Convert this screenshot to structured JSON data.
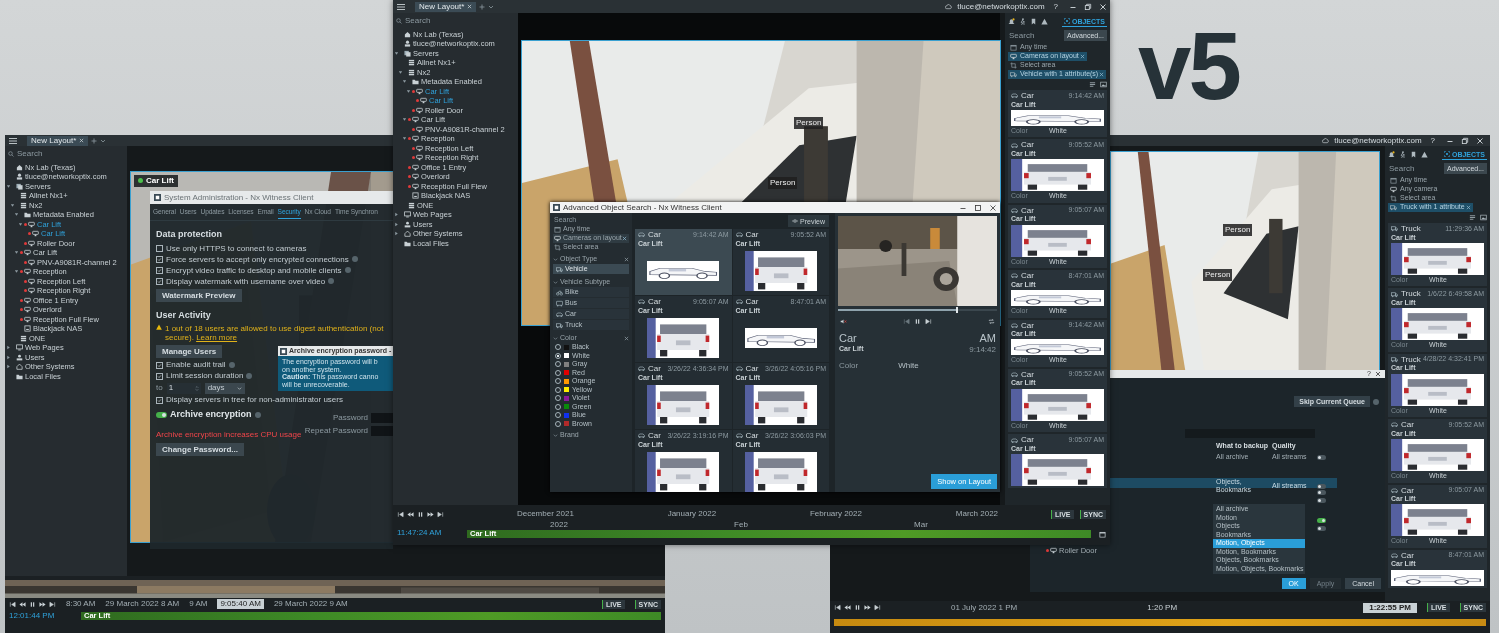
{
  "badge": {
    "label": "v5"
  },
  "left_window": {
    "tabs": [
      {
        "label": "New Layout*",
        "selected": true
      }
    ],
    "search": {
      "placeholder": "Search"
    },
    "tree": [
      {
        "label": "Nx Lab (Texas)",
        "kind": "site",
        "selected": false
      },
      {
        "label": "tluce@networkoptix.com",
        "kind": "user",
        "selected": false
      },
      {
        "label": "Servers",
        "kind": "servers",
        "selected": false,
        "expanded": true,
        "children": [
          {
            "label": "Allnet Nx1+",
            "kind": "server",
            "selected": false
          },
          {
            "label": "Nx2",
            "kind": "server",
            "selected": false,
            "expanded": true,
            "children": [
              {
                "label": "Metadata Enabled",
                "kind": "folder",
                "selected": false,
                "expanded": true,
                "children": [
                  {
                    "label": "Car Lift",
                    "kind": "camera",
                    "selected": true,
                    "recording": true,
                    "expanded": true,
                    "children": [
                      {
                        "label": "Car Lift",
                        "kind": "camera",
                        "selected": true,
                        "recording": true
                      }
                    ]
                  },
                  {
                    "label": "Roller Door",
                    "kind": "camera",
                    "selected": false,
                    "recording": true
                  }
                ]
              },
              {
                "label": "Car Lift",
                "kind": "camera",
                "selected": false,
                "recording": true,
                "expanded": true,
                "children": [
                  {
                    "label": "PNV-A9081R-channel 2",
                    "kind": "camera",
                    "selected": false,
                    "recording": true
                  }
                ]
              },
              {
                "label": "Reception",
                "kind": "camera",
                "selected": false,
                "recording": true,
                "expanded": true,
                "children": [
                  {
                    "label": "Reception Left",
                    "kind": "camera",
                    "selected": false,
                    "recording": true
                  },
                  {
                    "label": "Reception Right",
                    "kind": "camera",
                    "selected": false,
                    "recording": true
                  }
                ]
              },
              {
                "label": "Office 1 Entry",
                "kind": "camera",
                "selected": false,
                "recording": true
              },
              {
                "label": "Overlord",
                "kind": "camera",
                "selected": false,
                "recording": true
              },
              {
                "label": "Reception Full Flew",
                "kind": "camera",
                "selected": false,
                "recording": true
              },
              {
                "label": "Blackjack NAS",
                "kind": "nas",
                "selected": false
              }
            ]
          },
          {
            "label": "ONE",
            "kind": "server",
            "selected": false
          }
        ]
      },
      {
        "label": "Web Pages",
        "kind": "web",
        "selected": false,
        "expanded": false
      },
      {
        "label": "Users",
        "kind": "users",
        "selected": false,
        "expanded": false
      },
      {
        "label": "Other Systems",
        "kind": "systems",
        "selected": false,
        "expanded": false
      },
      {
        "label": "Local Files",
        "kind": "files",
        "selected": false
      }
    ],
    "tile": {
      "title": "Car Lift",
      "online": true
    },
    "admin_dialog": {
      "title": "System Administration - Nx Witness Client",
      "tabs": [
        {
          "label": "General",
          "selected": false
        },
        {
          "label": "Users",
          "selected": false
        },
        {
          "label": "Updates",
          "selected": false
        },
        {
          "label": "Licenses",
          "selected": false
        },
        {
          "label": "Email",
          "selected": false
        },
        {
          "label": "Security",
          "selected": true
        },
        {
          "label": "Nx Cloud",
          "selected": false
        },
        {
          "label": "Time Synchron",
          "selected": false
        }
      ],
      "items": [
        {
          "kind": "heading",
          "text": "Data protection"
        },
        {
          "kind": "checkbox",
          "text": "Use only HTTPS to connect to cameras",
          "checked": false,
          "help": false
        },
        {
          "kind": "checkbox",
          "text": "Force servers to accept only encrypted connections",
          "checked": true,
          "help": true
        },
        {
          "kind": "checkbox",
          "text": "Encrypt video traffic to desktop and mobile clients",
          "checked": true,
          "help": true
        },
        {
          "kind": "checkbox",
          "text": "Display watermark with username over video",
          "checked": true,
          "help": true
        },
        {
          "kind": "button",
          "text": "Watermark Preview"
        },
        {
          "kind": "heading",
          "text": "User Activity"
        },
        {
          "kind": "warning",
          "text": "1 out of 18 users are allowed to use digest authentication (not secure).",
          "link": "Learn more"
        },
        {
          "kind": "button",
          "text": "Manage Users"
        },
        {
          "kind": "checkbox",
          "text": "Enable audit trail",
          "checked": true,
          "help": true
        },
        {
          "kind": "checkbox",
          "text": "Limit session duration",
          "checked": true,
          "help": true
        },
        {
          "kind": "duration",
          "prefix": "to",
          "value": "1",
          "unit": "days"
        },
        {
          "kind": "checkbox",
          "text": "Display servers in tree for non-administrator users",
          "checked": true,
          "help": false
        },
        {
          "kind": "switch",
          "text": "Archive encryption",
          "on": true,
          "help": true
        },
        {
          "kind": "error",
          "text": "Archive encryption increases CPU usage"
        },
        {
          "kind": "button",
          "text": "Change Password..."
        }
      ]
    },
    "password_popup": {
      "title": "Archive encryption password -",
      "lines": [
        "The encryption password will b",
        "on another system.",
        "**Caution:** This password canno",
        "will be unrecoverable."
      ],
      "fields": [
        {
          "label": "Password"
        },
        {
          "label": "Repeat Password"
        }
      ]
    },
    "timeline": {
      "date_left": "29 March 2022 8 AM",
      "cursor": "9:05:40 AM",
      "date_right": "29 March 2022 9 AM",
      "ticks": [
        "8:30 AM",
        "9 AM"
      ],
      "clock": "12:01:44 PM",
      "live": "LIVE",
      "sync": "SYNC",
      "track": "Car Lift"
    }
  },
  "center_window": {
    "tabs": [
      {
        "label": "New Layout*",
        "selected": true
      }
    ],
    "user": "tluce@networkoptix.com",
    "help": "?",
    "search": {
      "placeholder": "Search"
    },
    "tree": [
      {
        "label": "Nx Lab (Texas)",
        "kind": "site",
        "selected": false
      },
      {
        "label": "tluce@networkoptix.com",
        "kind": "user",
        "selected": false
      },
      {
        "label": "Servers",
        "kind": "servers",
        "selected": false,
        "expanded": true,
        "children": [
          {
            "label": "Allnet Nx1+",
            "kind": "server",
            "selected": false
          },
          {
            "label": "Nx2",
            "kind": "server",
            "selected": false,
            "expanded": true,
            "children": [
              {
                "label": "Metadata Enabled",
                "kind": "folder",
                "selected": false,
                "expanded": true,
                "children": [
                  {
                    "label": "Car Lift",
                    "kind": "camera",
                    "selected": true,
                    "recording": true,
                    "expanded": true,
                    "children": [
                      {
                        "label": "Car Lift",
                        "kind": "camera",
                        "selected": true,
                        "recording": true
                      }
                    ]
                  },
                  {
                    "label": "Roller Door",
                    "kind": "camera",
                    "selected": false,
                    "recording": true
                  }
                ]
              },
              {
                "label": "Car Lift",
                "kind": "camera",
                "selected": false,
                "recording": true,
                "expanded": true,
                "children": [
                  {
                    "label": "PNV-A9081R-channel 2",
                    "kind": "camera",
                    "selected": false,
                    "recording": true
                  }
                ]
              },
              {
                "label": "Reception",
                "kind": "camera",
                "selected": false,
                "recording": true,
                "expanded": true,
                "children": [
                  {
                    "label": "Reception Left",
                    "kind": "camera",
                    "selected": false,
                    "recording": true
                  },
                  {
                    "label": "Reception Right",
                    "kind": "camera",
                    "selected": false,
                    "recording": true
                  }
                ]
              },
              {
                "label": "Office 1 Entry",
                "kind": "camera",
                "selected": false,
                "recording": true
              },
              {
                "label": "Overlord",
                "kind": "camera",
                "selected": false,
                "recording": true
              },
              {
                "label": "Reception Full Flew",
                "kind": "camera",
                "selected": false,
                "recording": true
              },
              {
                "label": "Blackjack NAS",
                "kind": "nas",
                "selected": false
              }
            ]
          },
          {
            "label": "ONE",
            "kind": "server",
            "selected": false
          }
        ]
      },
      {
        "label": "Web Pages",
        "kind": "web",
        "selected": false,
        "expanded": false
      },
      {
        "label": "Users",
        "kind": "users",
        "selected": false,
        "expanded": false
      },
      {
        "label": "Other Systems",
        "kind": "systems",
        "selected": false,
        "expanded": false
      },
      {
        "label": "Local Files",
        "kind": "files",
        "selected": false
      }
    ],
    "video": {
      "detections": [
        {
          "label": "Person"
        },
        {
          "label": "Person"
        }
      ]
    },
    "search_dialog": {
      "title": "Advanced Object Search - Nx Witness Client",
      "search": {
        "placeholder": "Search"
      },
      "filters": [
        {
          "label": "Any time",
          "kind": "time",
          "selected": false
        },
        {
          "label": "Cameras on layout",
          "kind": "camera",
          "selected": true
        },
        {
          "label": "Select area",
          "kind": "area",
          "selected": false
        }
      ],
      "object_type": {
        "title": "Object Type",
        "options": [
          {
            "label": "Vehicle",
            "kind": "truck",
            "selected": true
          }
        ]
      },
      "subtype": {
        "title": "Vehicle Subtype",
        "options": [
          {
            "label": "Bike",
            "kind": "bike",
            "selected": false
          },
          {
            "label": "Bus",
            "kind": "bus",
            "selected": false
          },
          {
            "label": "Car",
            "kind": "car",
            "selected": false
          },
          {
            "label": "Truck",
            "kind": "truck",
            "selected": false
          }
        ]
      },
      "colors": {
        "title": "Color",
        "options": [
          {
            "label": "Black",
            "color": "#111111",
            "selected": false
          },
          {
            "label": "White",
            "color": "#ffffff",
            "selected": true
          },
          {
            "label": "Gray",
            "color": "#808080",
            "selected": false
          },
          {
            "label": "Red",
            "color": "#e00000",
            "selected": false
          },
          {
            "label": "Orange",
            "color": "#ff9900",
            "selected": false
          },
          {
            "label": "Yellow",
            "color": "#ffee00",
            "selected": false
          },
          {
            "label": "Violet",
            "color": "#8a1a9a",
            "selected": false
          },
          {
            "label": "Green",
            "color": "#0a8a0a",
            "selected": false
          },
          {
            "label": "Blue",
            "color": "#1030ee",
            "selected": false
          },
          {
            "label": "Brown",
            "color": "#b02a2a",
            "selected": false
          }
        ]
      },
      "brand": {
        "title": "Brand"
      },
      "preview_button": "Preview",
      "results": [
        {
          "type": "Car",
          "camera": "Car Lift",
          "time": "9:14:42 AM",
          "kind": "carside",
          "selected": true
        },
        {
          "type": "Car",
          "camera": "Car Lift",
          "time": "9:05:52 AM",
          "kind": "carrear",
          "selected": false
        },
        {
          "type": "Car",
          "camera": "Car Lift",
          "time": "9:05:07 AM",
          "kind": "carrear",
          "selected": false
        },
        {
          "type": "Car",
          "camera": "Car Lift",
          "time": "8:47:01 AM",
          "kind": "carside",
          "selected": false
        },
        {
          "type": "Car",
          "camera": "Car Lift",
          "time": "3/26/22 4:36:34 PM",
          "kind": "carrear",
          "selected": false
        },
        {
          "type": "Car",
          "camera": "Car Lift",
          "time": "3/26/22 4:05:16 PM",
          "kind": "carrear",
          "selected": false
        },
        {
          "type": "Car",
          "camera": "Car Lift",
          "time": "3/26/22 3:19:16 PM",
          "kind": "carrear",
          "selected": false
        },
        {
          "type": "Car",
          "camera": "Car Lift",
          "time": "3/26/22 3:06:03 PM",
          "kind": "carrear",
          "selected": false
        }
      ],
      "preview": {
        "level": 0.74,
        "type": "Car",
        "camera": "Car Lift",
        "ampm": "AM",
        "time": "9:14:42",
        "attr_label": "Color",
        "attr_value": "White",
        "muted": true
      },
      "show_button": "Show on Layout"
    },
    "panel": {
      "tab": "OBJECTS",
      "search": {
        "placeholder": "Search"
      },
      "advanced": "Advanced...",
      "filters": [
        {
          "label": "Any time",
          "kind": "time",
          "selected": false
        },
        {
          "label": "Cameras on layout",
          "kind": "camera",
          "selected": true
        },
        {
          "label": "Select area",
          "kind": "area",
          "selected": false
        },
        {
          "label": "Vehicle with 1 attribute(s)",
          "kind": "truck",
          "selected": true
        }
      ],
      "cards": [
        {
          "type": "Car",
          "camera": "Car Lift",
          "time": "9:14:42 AM",
          "kind": "carside",
          "attr_label": "Color",
          "attr_value": "White"
        },
        {
          "type": "Car",
          "camera": "Car Lift",
          "time": "9:05:52 AM",
          "kind": "carrear",
          "attr_label": "Color",
          "attr_value": "White"
        },
        {
          "type": "Car",
          "camera": "Car Lift",
          "time": "9:05:07 AM",
          "kind": "carrear",
          "attr_label": "Color",
          "attr_value": "White"
        },
        {
          "type": "Car",
          "camera": "Car Lift",
          "time": "8:47:01 AM",
          "kind": "carside",
          "attr_label": "Color",
          "attr_value": "White"
        },
        {
          "type": "Car",
          "camera": "Car Lift",
          "time": "9:14:42 AM",
          "kind": "carside",
          "attr_label": "Color",
          "attr_value": "White"
        },
        {
          "type": "Car",
          "camera": "Car Lift",
          "time": "9:05:52 AM",
          "kind": "carrear",
          "attr_label": "Color",
          "attr_value": "White"
        },
        {
          "type": "Car",
          "camera": "Car Lift",
          "time": "9:05:07 AM",
          "kind": "carrear"
        }
      ]
    },
    "timeline": {
      "months": [
        "December 2021",
        "January 2022",
        "February 2022",
        "March 2022"
      ],
      "years": [
        "2022",
        "Feb",
        "Mar"
      ],
      "clock": "11:47:24 AM",
      "live": "LIVE",
      "sync": "SYNC",
      "track": "Car Lift"
    }
  },
  "right_window": {
    "user": "tluce@networkoptix.com",
    "help": "?",
    "video": {
      "detections": [
        {
          "label": "Person"
        },
        {
          "label": "Person"
        }
      ]
    },
    "panel": {
      "tab": "OBJECTS",
      "search": {
        "placeholder": "Search"
      },
      "advanced": "Advanced...",
      "filters": [
        {
          "label": "Any time",
          "kind": "time",
          "selected": false
        },
        {
          "label": "Any camera",
          "kind": "camera",
          "selected": false
        },
        {
          "label": "Select area",
          "kind": "area",
          "selected": false
        },
        {
          "label": "Truck with 1 attribute",
          "kind": "truck",
          "selected": true
        }
      ],
      "cards": [
        {
          "type": "Truck",
          "camera": "Car Lift",
          "time": "11:29:36 AM",
          "kind": "truckrear",
          "attr_label": "Color",
          "attr_value": "White"
        },
        {
          "type": "Truck",
          "camera": "Car Lift",
          "time": "1/6/22 6:49:58 AM",
          "kind": "truckrear",
          "attr_label": "Color",
          "attr_value": "White"
        },
        {
          "type": "Truck",
          "camera": "Car Lift",
          "time": "4/28/22 4:32:41 PM",
          "kind": "truckrear",
          "attr_label": "Color",
          "attr_value": "White"
        },
        {
          "type": "Car",
          "camera": "Car Lift",
          "time": "9:05:52 AM",
          "kind": "carrear",
          "attr_label": "Color",
          "attr_value": "White"
        },
        {
          "type": "Car",
          "camera": "Car Lift",
          "time": "9:05:07 AM",
          "kind": "carrear",
          "attr_label": "Color",
          "attr_value": "White"
        },
        {
          "type": "Car",
          "camera": "Car Lift",
          "time": "8:47:01 AM",
          "kind": "carside"
        }
      ]
    },
    "backup_dialog": {
      "help": "?",
      "skip_button": "Skip Current Queue",
      "col_what": "What to backup",
      "col_quality": "Quality",
      "rows": [
        {
          "what": "All archive",
          "quality": "All streams",
          "on": false,
          "selected": false
        },
        {
          "what": "Objects, Bookmarks",
          "quality": "All streams",
          "on": false,
          "selected": true
        }
      ],
      "extra_toggles": [
        {
          "on": false
        },
        {
          "on": false
        },
        {
          "on": true
        },
        {
          "on": false
        }
      ],
      "menu": [
        {
          "label": "All archive",
          "selected": false
        },
        {
          "label": "Motion",
          "selected": false
        },
        {
          "label": "Objects",
          "selected": false
        },
        {
          "label": "Bookmarks",
          "selected": false
        },
        {
          "label": "Motion, Objects",
          "selected": true
        },
        {
          "label": "Motion, Bookmarks",
          "selected": false
        },
        {
          "label": "Objects, Bookmarks",
          "selected": false
        },
        {
          "label": "Motion, Objects, Bookmarks",
          "selected": false
        }
      ],
      "device": {
        "label": "Roller Door",
        "recording": true
      },
      "buttons": [
        {
          "label": "OK",
          "kind": "primary"
        },
        {
          "label": "Apply",
          "kind": "disabled"
        },
        {
          "label": "Cancel",
          "kind": "normal"
        }
      ]
    },
    "timeline": {
      "cursor": "1:22:55 PM",
      "date": "01 July 2022 1 PM",
      "tick": "1:20 PM",
      "live": "LIVE",
      "sync": "SYNC"
    }
  }
}
